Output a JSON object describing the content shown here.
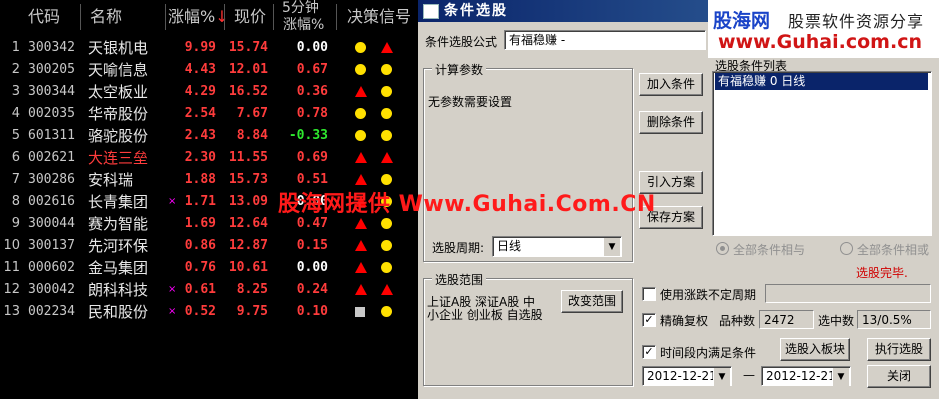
{
  "grid": {
    "headers": {
      "code": "代码",
      "name": "名称",
      "pct": "涨幅%",
      "pct_sort": "↓",
      "price": "现价",
      "m5_top": "5分钟",
      "m5_bottom": "涨幅%",
      "signal": "决策信号"
    },
    "rows": [
      {
        "idx": "1",
        "code": "300342",
        "name": "天银机电",
        "mark": "",
        "pct": "9.99",
        "price": "15.74",
        "m5": "0.00",
        "m5_color": "white",
        "name_color": "",
        "sig_a": "dot",
        "sig_b": "tri"
      },
      {
        "idx": "2",
        "code": "300205",
        "name": "天喻信息",
        "mark": "",
        "pct": "4.43",
        "price": "12.01",
        "m5": "0.67",
        "m5_color": "red",
        "name_color": "",
        "sig_a": "dot",
        "sig_b": "dot"
      },
      {
        "idx": "3",
        "code": "300344",
        "name": "太空板业",
        "mark": "",
        "pct": "4.29",
        "price": "16.52",
        "m5": "0.36",
        "m5_color": "red",
        "name_color": "",
        "sig_a": "tri",
        "sig_b": "dot"
      },
      {
        "idx": "4",
        "code": "002035",
        "name": "华帝股份",
        "mark": "",
        "pct": "2.54",
        "price": "7.67",
        "m5": "0.78",
        "m5_color": "red",
        "name_color": "",
        "sig_a": "dot",
        "sig_b": "dot"
      },
      {
        "idx": "5",
        "code": "601311",
        "name": "骆驼股份",
        "mark": "",
        "pct": "2.43",
        "price": "8.84",
        "m5": "-0.33",
        "m5_color": "green",
        "name_color": "",
        "sig_a": "dot",
        "sig_b": "dot"
      },
      {
        "idx": "6",
        "code": "002621",
        "name": "大连三垒",
        "mark": "",
        "pct": "2.30",
        "price": "11.55",
        "m5": "0.69",
        "m5_color": "red",
        "name_color": "red",
        "sig_a": "tri",
        "sig_b": "tri"
      },
      {
        "idx": "7",
        "code": "300286",
        "name": "安科瑞",
        "mark": "",
        "pct": "1.88",
        "price": "15.73",
        "m5": "0.51",
        "m5_color": "red",
        "name_color": "",
        "sig_a": "tri",
        "sig_b": "dot"
      },
      {
        "idx": "8",
        "code": "002616",
        "name": "长青集团",
        "mark": "×",
        "pct": "1.71",
        "price": "13.09",
        "m5": "0.00",
        "m5_color": "white",
        "name_color": "",
        "sig_a": "tri",
        "sig_b": "dot"
      },
      {
        "idx": "9",
        "code": "300044",
        "name": "赛为智能",
        "mark": "",
        "pct": "1.69",
        "price": "12.64",
        "m5": "0.47",
        "m5_color": "red",
        "name_color": "",
        "sig_a": "tri",
        "sig_b": "dot"
      },
      {
        "idx": "10",
        "code": "300137",
        "name": "先河环保",
        "mark": "",
        "pct": "0.86",
        "price": "12.87",
        "m5": "0.15",
        "m5_color": "red",
        "name_color": "",
        "sig_a": "tri",
        "sig_b": "dot"
      },
      {
        "idx": "11",
        "code": "000602",
        "name": "金马集团",
        "mark": "",
        "pct": "0.76",
        "price": "10.61",
        "m5": "0.00",
        "m5_color": "white",
        "name_color": "",
        "sig_a": "tri",
        "sig_b": "dot"
      },
      {
        "idx": "12",
        "code": "300042",
        "name": "朗科科技",
        "mark": "×",
        "pct": "0.61",
        "price": "8.25",
        "m5": "0.24",
        "m5_color": "red",
        "name_color": "",
        "sig_a": "tri",
        "sig_b": "tri"
      },
      {
        "idx": "13",
        "code": "002234",
        "name": "民和股份",
        "mark": "×",
        "pct": "0.52",
        "price": "9.75",
        "m5": "0.10",
        "m5_color": "red",
        "name_color": "",
        "sig_a": "square",
        "sig_b": "dot"
      }
    ]
  },
  "watermark": {
    "center": "股海网提供 Www.Guhai.Com.CN",
    "logo_main": "股海网",
    "logo_sub": "股票软件资源分享",
    "logo_url": "www.Guhai.com.cn"
  },
  "dialog": {
    "title": "条件选股",
    "formula_label": "条件选股公式",
    "formula_value": "有福稳赚 -",
    "calc_group": "计算参数",
    "no_params": "无参数需要设置",
    "period_label": "选股周期:",
    "period_value": "日线",
    "range_group": "选股范围",
    "range_line1": "上证A股 深证A股 中",
    "range_line2": "小企业 创业板 自选股",
    "change_range_button": "改变范围",
    "add_button": "加入条件",
    "delete_button": "删除条件",
    "import_button": "引入方案",
    "save_button": "保存方案",
    "list_title": "选股条件列表",
    "list_items": [
      "有福稳赚  0  日线"
    ],
    "radio_and": "全部条件相与",
    "radio_or": "全部条件相或",
    "status": "选股完毕.",
    "use_period_label": "使用涨跌不定周期",
    "exact_fq_label": "精确复权",
    "count_label": "品种数",
    "count_value": "2472",
    "selected_label": "选中数",
    "selected_value": "13/0.5%",
    "time_range_label": "时间段内满足条件",
    "to_board_button": "选股入板块",
    "execute_button": "执行选股",
    "close_button": "关闭",
    "date_from": "2012-12-21",
    "date_to": "2012-12-21",
    "date_sep": "—",
    "check_mark": "✓"
  }
}
